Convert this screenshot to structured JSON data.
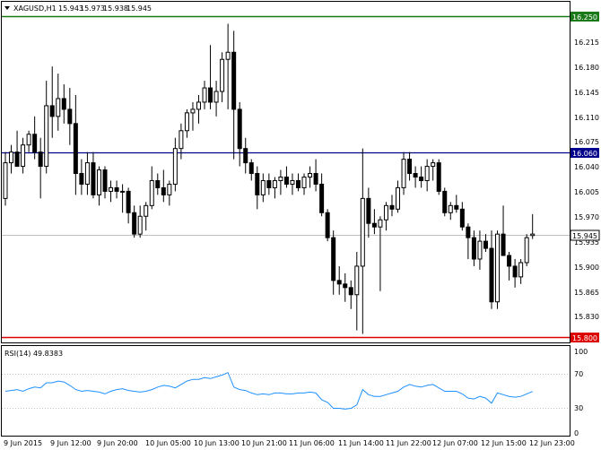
{
  "header": {
    "symbol": "XAGUSD,H1",
    "open": "15.943",
    "high": "15.973",
    "low": "15.938",
    "close": "15.945",
    "menu_icon": "triangle-down-icon"
  },
  "colors": {
    "background": "#ffffff",
    "candle": "#000000",
    "level_green": "#1a7a1a",
    "level_blue": "#00008b",
    "level_red": "#dd0000",
    "current_price_line": "#c0c0c0",
    "rsi_line": "#1e90ff",
    "rsi_levels": "#c0c0c0"
  },
  "price_axis": {
    "labels": [
      "16.215",
      "16.180",
      "16.145",
      "16.110",
      "16.075",
      "16.040",
      "16.005",
      "15.970",
      "15.935",
      "15.900",
      "15.865",
      "15.830"
    ]
  },
  "levels": [
    {
      "name": "resistance-green",
      "value": 16.25,
      "label": "16.250",
      "color": "#1a7a1a"
    },
    {
      "name": "level-blue",
      "value": 16.06,
      "label": "16.060",
      "color": "#00008b"
    },
    {
      "name": "support-red",
      "value": 15.8,
      "label": "15.800",
      "color": "#dd0000"
    }
  ],
  "current_price": {
    "value": 15.945,
    "label": "15.945"
  },
  "rsi": {
    "title": "RSI(14) 49.8383",
    "axis_labels": [
      "100",
      "70",
      "30",
      "0"
    ],
    "levels": [
      70,
      30
    ]
  },
  "time_axis": {
    "labels": [
      "9 Jun 2015",
      "9 Jun 12:00",
      "9 Jun 20:00",
      "10 Jun 05:00",
      "10 Jun 13:00",
      "10 Jun 21:00",
      "11 Jun 06:00",
      "11 Jun 14:00",
      "11 Jun 22:00",
      "12 Jun 07:00",
      "12 Jun 15:00",
      "12 Jun 23:00"
    ]
  },
  "chart_data": {
    "type": "candlestick",
    "title": "XAGUSD,H1",
    "ylim": [
      15.795,
      16.26
    ],
    "candles": [
      {
        "o": 15.995,
        "h": 16.06,
        "l": 15.985,
        "c": 16.045
      },
      {
        "o": 16.045,
        "h": 16.07,
        "l": 16.03,
        "c": 16.06
      },
      {
        "o": 16.06,
        "h": 16.09,
        "l": 16.05,
        "c": 16.04
      },
      {
        "o": 16.04,
        "h": 16.08,
        "l": 16.03,
        "c": 16.07
      },
      {
        "o": 16.07,
        "h": 16.09,
        "l": 16.06,
        "c": 16.085
      },
      {
        "o": 16.085,
        "h": 16.11,
        "l": 16.05,
        "c": 16.06
      },
      {
        "o": 16.06,
        "h": 16.08,
        "l": 15.995,
        "c": 16.04
      },
      {
        "o": 16.04,
        "h": 16.16,
        "l": 16.03,
        "c": 16.125
      },
      {
        "o": 16.125,
        "h": 16.18,
        "l": 16.08,
        "c": 16.11
      },
      {
        "o": 16.11,
        "h": 16.17,
        "l": 16.09,
        "c": 16.135
      },
      {
        "o": 16.135,
        "h": 16.155,
        "l": 16.1,
        "c": 16.12
      },
      {
        "o": 16.12,
        "h": 16.15,
        "l": 16.07,
        "c": 16.1
      },
      {
        "o": 16.1,
        "h": 16.14,
        "l": 16.0,
        "c": 16.03
      },
      {
        "o": 16.03,
        "h": 16.05,
        "l": 16.0,
        "c": 16.015
      },
      {
        "o": 16.015,
        "h": 16.06,
        "l": 16.0,
        "c": 16.045
      },
      {
        "o": 16.045,
        "h": 16.06,
        "l": 15.995,
        "c": 16.0
      },
      {
        "o": 16.0,
        "h": 16.04,
        "l": 15.985,
        "c": 16.035
      },
      {
        "o": 16.035,
        "h": 16.04,
        "l": 15.995,
        "c": 16.005
      },
      {
        "o": 16.005,
        "h": 16.02,
        "l": 15.99,
        "c": 16.01
      },
      {
        "o": 16.01,
        "h": 16.02,
        "l": 15.995,
        "c": 16.005
      },
      {
        "o": 16.005,
        "h": 16.015,
        "l": 15.975,
        "c": 16.005
      },
      {
        "o": 16.005,
        "h": 16.01,
        "l": 15.96,
        "c": 15.975
      },
      {
        "o": 15.975,
        "h": 15.985,
        "l": 15.94,
        "c": 15.945
      },
      {
        "o": 15.945,
        "h": 15.985,
        "l": 15.94,
        "c": 15.97
      },
      {
        "o": 15.97,
        "h": 15.99,
        "l": 15.95,
        "c": 15.985
      },
      {
        "o": 15.985,
        "h": 16.04,
        "l": 15.98,
        "c": 16.02
      },
      {
        "o": 16.02,
        "h": 16.03,
        "l": 16.0,
        "c": 16.01
      },
      {
        "o": 16.01,
        "h": 16.035,
        "l": 15.99,
        "c": 16.0
      },
      {
        "o": 16.0,
        "h": 16.02,
        "l": 15.985,
        "c": 16.015
      },
      {
        "o": 16.015,
        "h": 16.08,
        "l": 16.005,
        "c": 16.065
      },
      {
        "o": 16.065,
        "h": 16.1,
        "l": 16.05,
        "c": 16.09
      },
      {
        "o": 16.09,
        "h": 16.12,
        "l": 16.08,
        "c": 16.115
      },
      {
        "o": 16.115,
        "h": 16.13,
        "l": 16.09,
        "c": 16.12
      },
      {
        "o": 16.12,
        "h": 16.14,
        "l": 16.1,
        "c": 16.13
      },
      {
        "o": 16.13,
        "h": 16.16,
        "l": 16.12,
        "c": 16.15
      },
      {
        "o": 16.15,
        "h": 16.21,
        "l": 16.12,
        "c": 16.13
      },
      {
        "o": 16.13,
        "h": 16.16,
        "l": 16.11,
        "c": 16.145
      },
      {
        "o": 16.145,
        "h": 16.2,
        "l": 16.13,
        "c": 16.19
      },
      {
        "o": 16.19,
        "h": 16.24,
        "l": 16.12,
        "c": 16.2
      },
      {
        "o": 16.2,
        "h": 16.23,
        "l": 16.05,
        "c": 16.12
      },
      {
        "o": 16.12,
        "h": 16.13,
        "l": 16.04,
        "c": 16.065
      },
      {
        "o": 16.065,
        "h": 16.08,
        "l": 16.03,
        "c": 16.045
      },
      {
        "o": 16.045,
        "h": 16.05,
        "l": 16.02,
        "c": 16.03
      },
      {
        "o": 16.03,
        "h": 16.04,
        "l": 15.98,
        "c": 16.0
      },
      {
        "o": 16.0,
        "h": 16.03,
        "l": 15.99,
        "c": 16.02
      },
      {
        "o": 16.02,
        "h": 16.03,
        "l": 16.0,
        "c": 16.01
      },
      {
        "o": 16.01,
        "h": 16.025,
        "l": 15.995,
        "c": 16.02
      },
      {
        "o": 16.02,
        "h": 16.035,
        "l": 16.0,
        "c": 16.025
      },
      {
        "o": 16.025,
        "h": 16.04,
        "l": 16.01,
        "c": 16.015
      },
      {
        "o": 16.015,
        "h": 16.03,
        "l": 16.0,
        "c": 16.02
      },
      {
        "o": 16.02,
        "h": 16.03,
        "l": 16.005,
        "c": 16.01
      },
      {
        "o": 16.01,
        "h": 16.03,
        "l": 16.0,
        "c": 16.025
      },
      {
        "o": 16.025,
        "h": 16.04,
        "l": 16.01,
        "c": 16.03
      },
      {
        "o": 16.03,
        "h": 16.05,
        "l": 16.005,
        "c": 16.015
      },
      {
        "o": 16.015,
        "h": 16.03,
        "l": 15.97,
        "c": 15.975
      },
      {
        "o": 15.975,
        "h": 15.98,
        "l": 15.935,
        "c": 15.94
      },
      {
        "o": 15.94,
        "h": 15.95,
        "l": 15.86,
        "c": 15.88
      },
      {
        "o": 15.88,
        "h": 15.9,
        "l": 15.86,
        "c": 15.875
      },
      {
        "o": 15.875,
        "h": 15.89,
        "l": 15.85,
        "c": 15.87
      },
      {
        "o": 15.87,
        "h": 15.88,
        "l": 15.84,
        "c": 15.86
      },
      {
        "o": 15.86,
        "h": 15.92,
        "l": 15.81,
        "c": 15.9
      },
      {
        "o": 15.9,
        "h": 16.065,
        "l": 15.805,
        "c": 15.995
      },
      {
        "o": 15.995,
        "h": 16.01,
        "l": 15.94,
        "c": 15.96
      },
      {
        "o": 15.96,
        "h": 15.98,
        "l": 15.945,
        "c": 15.955
      },
      {
        "o": 15.955,
        "h": 15.97,
        "l": 15.865,
        "c": 15.965
      },
      {
        "o": 15.965,
        "h": 15.99,
        "l": 15.95,
        "c": 15.985
      },
      {
        "o": 15.985,
        "h": 16.0,
        "l": 15.97,
        "c": 15.98
      },
      {
        "o": 15.98,
        "h": 16.02,
        "l": 15.975,
        "c": 16.01
      },
      {
        "o": 16.01,
        "h": 16.06,
        "l": 16.0,
        "c": 16.05
      },
      {
        "o": 16.05,
        "h": 16.06,
        "l": 16.02,
        "c": 16.03
      },
      {
        "o": 16.03,
        "h": 16.04,
        "l": 16.01,
        "c": 16.025
      },
      {
        "o": 16.025,
        "h": 16.04,
        "l": 16.01,
        "c": 16.02
      },
      {
        "o": 16.02,
        "h": 16.05,
        "l": 16.005,
        "c": 16.04
      },
      {
        "o": 16.04,
        "h": 16.05,
        "l": 16.02,
        "c": 16.045
      },
      {
        "o": 16.045,
        "h": 16.05,
        "l": 16.0,
        "c": 16.005
      },
      {
        "o": 16.005,
        "h": 16.01,
        "l": 15.97,
        "c": 15.975
      },
      {
        "o": 15.975,
        "h": 15.99,
        "l": 15.965,
        "c": 15.985
      },
      {
        "o": 15.985,
        "h": 16.0,
        "l": 15.975,
        "c": 15.98
      },
      {
        "o": 15.98,
        "h": 15.99,
        "l": 15.95,
        "c": 15.955
      },
      {
        "o": 15.955,
        "h": 15.96,
        "l": 15.91,
        "c": 15.94
      },
      {
        "o": 15.94,
        "h": 15.95,
        "l": 15.9,
        "c": 15.91
      },
      {
        "o": 15.91,
        "h": 15.95,
        "l": 15.895,
        "c": 15.935
      },
      {
        "o": 15.935,
        "h": 15.945,
        "l": 15.92,
        "c": 15.925
      },
      {
        "o": 15.925,
        "h": 15.95,
        "l": 15.84,
        "c": 15.85
      },
      {
        "o": 15.85,
        "h": 15.95,
        "l": 15.84,
        "c": 15.945
      },
      {
        "o": 15.945,
        "h": 15.985,
        "l": 15.93,
        "c": 15.915
      },
      {
        "o": 15.915,
        "h": 15.92,
        "l": 15.88,
        "c": 15.9
      },
      {
        "o": 15.9,
        "h": 15.91,
        "l": 15.87,
        "c": 15.885
      },
      {
        "o": 15.885,
        "h": 15.91,
        "l": 15.875,
        "c": 15.905
      },
      {
        "o": 15.905,
        "h": 15.945,
        "l": 15.9,
        "c": 15.94
      },
      {
        "o": 15.943,
        "h": 15.973,
        "l": 15.938,
        "c": 15.945
      }
    ],
    "rsi_values": [
      50,
      51,
      52,
      50,
      53,
      55,
      54,
      60,
      60,
      62,
      61,
      57,
      52,
      50,
      51,
      50,
      49,
      47,
      50,
      52,
      53,
      51,
      50,
      49,
      50,
      52,
      55,
      57,
      56,
      54,
      58,
      62,
      64,
      64,
      66,
      65,
      67,
      69,
      72,
      55,
      52,
      51,
      48,
      46,
      47,
      46,
      48,
      48,
      47,
      47,
      48,
      48,
      49,
      48,
      40,
      37,
      30,
      30,
      29,
      30,
      34,
      52,
      46,
      44,
      44,
      46,
      48,
      50,
      55,
      58,
      56,
      55,
      57,
      58,
      54,
      50,
      50,
      50,
      47,
      42,
      41,
      44,
      42,
      36,
      48,
      46,
      44,
      43,
      44,
      47,
      49.8
    ]
  }
}
